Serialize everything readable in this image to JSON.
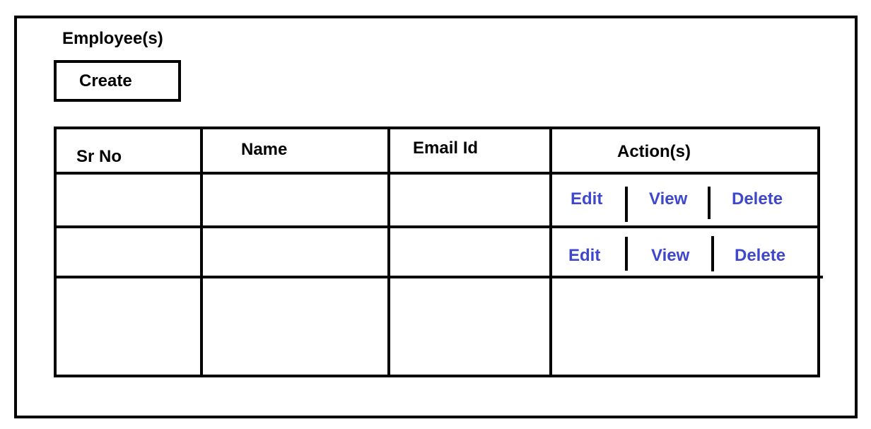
{
  "page": {
    "title": "Employee(s)",
    "create_label": "Create"
  },
  "table": {
    "columns": [
      "Sr No",
      "Name",
      "Email Id",
      "Action(s)"
    ],
    "rows": [
      {
        "sr_no": "",
        "name": "",
        "email": "",
        "actions": [
          "Edit",
          "View",
          "Delete"
        ]
      },
      {
        "sr_no": "",
        "name": "",
        "email": "",
        "actions": [
          "Edit",
          "View",
          "Delete"
        ]
      },
      {
        "sr_no": "",
        "name": "",
        "email": "",
        "actions": []
      }
    ]
  },
  "colors": {
    "border": "#000000",
    "action_link": "#3f48cc",
    "background": "#ffffff"
  }
}
